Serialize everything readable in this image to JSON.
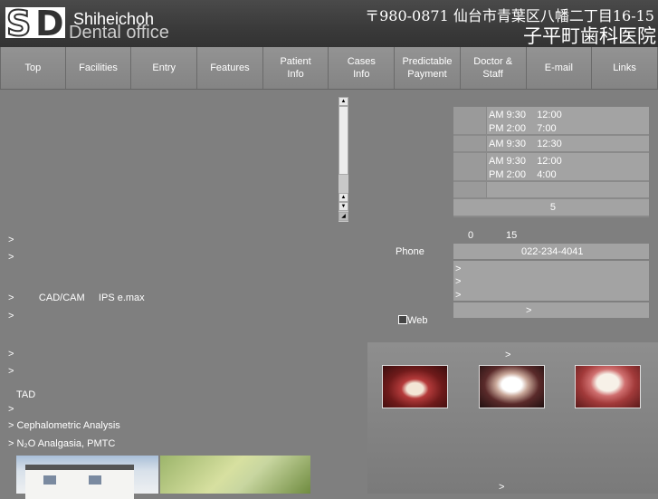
{
  "header": {
    "logo": "SD",
    "name_en": "Shiheichoh",
    "sub_en": "Dental office",
    "address": "〒980-0871 仙台市青葉区八幡二丁目16-15",
    "name_jp": "子平町歯科医院"
  },
  "nav": [
    {
      "label": "Top"
    },
    {
      "label": "Facilities"
    },
    {
      "label": "Entry"
    },
    {
      "label": "Features"
    },
    {
      "label": "Patient\nInfo"
    },
    {
      "label": "Cases\nInfo"
    },
    {
      "label": "Predictable\nPayment"
    },
    {
      "label": "Doctor &\nStaff"
    },
    {
      "label": "E-mail"
    },
    {
      "label": "Links"
    }
  ],
  "left_list": [
    ">",
    ">",
    ">         CAD/CAM     IPS e.max",
    ">",
    ">",
    ">",
    "TAD",
    ">",
    "> Cephalometric Analysis",
    "> N₂O Analgasia, PMTC"
  ],
  "hours": [
    "AM 9:30    12:00\nPM 2:00    7:00",
    "AM 9:30    12:30",
    "AM 9:30    12:00\nPM 2:00    4:00",
    "",
    "5"
  ],
  "info": {
    "num_0": "0",
    "num_15": "15",
    "phone_label": "Phone",
    "phone_value": "022-234-4041",
    "arrow": ">",
    "web_label": "Web"
  }
}
